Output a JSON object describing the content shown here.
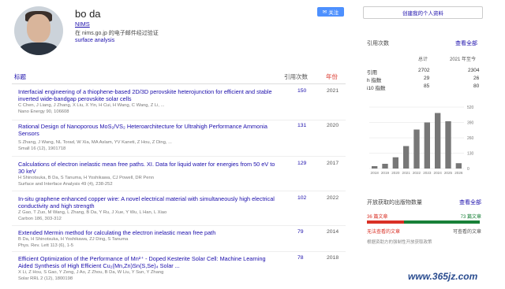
{
  "profile": {
    "name": "bo da",
    "affiliation": "NIMS",
    "email": "在 nims.go.jp 的电子邮件经过验证",
    "interest": "surface analysis",
    "follow_label": "关注"
  },
  "table": {
    "headers": {
      "title": "标题",
      "cited_by": "引用次数",
      "year": "年份"
    },
    "rows": [
      {
        "title": "Interfacial engineering of a thiophene-based 2D/3D perovskite heterojunction for efficient and stable inverted wide-bandgap perovskite solar cells",
        "authors": "C Chen, J Liang, J Zhang, X Liu, X Yin, H Cui, H Wang, C Wang, Z Li, ...",
        "venue": "Nano Energy 90, 106608",
        "cites": "150",
        "year": "2021"
      },
      {
        "title": "Rational Design of Nanoporous MoS₂/VS₂ Heteroarchitecture for Ultrahigh Performance Ammonia Sensors",
        "authors": "S Zhang, J Wang, NL Torad, W Xia, MA Aslam, YV Kaneti, Z Hou, Z Ding, ...",
        "venue": "Small 16 (12), 1901718",
        "cites": "131",
        "year": "2020"
      },
      {
        "title": "Calculations of electron inelastic mean free paths. XI. Data for liquid water for energies from 50 eV to 30 keV",
        "authors": "H Shinotsuka, B Da, S Tanuma, H Yoshikawa, CJ Powell, DR Penn",
        "venue": "Surface and Interface Analysis 49 (4), 238-252",
        "cites": "129",
        "year": "2017"
      },
      {
        "title": "In-situ graphene enhanced copper wire: A novel electrical material with simultaneously high electrical conductivity and high strength",
        "authors": "Z Gao, T Zuo, M Wang, L Zhang, B Da, Y Ru, J Xue, Y Wu, L Han, L Xiao",
        "venue": "Carbon 186, 303-312",
        "cites": "102",
        "year": "2022"
      },
      {
        "title": "Extended Mermin method for calculating the electron inelastic mean free path",
        "authors": "B Da, H Shinotsuka, H Yoshikawa, ZJ Ding, S Tanuma",
        "venue": "Phys. Rev. Lett 113 (6), 1-5",
        "cites": "79",
        "year": "2014"
      },
      {
        "title": "Efficient Optimization of the Performance of Mn²⁺ - Doped Kesterite Solar Cell: Machine Learning Aided Synthesis of High Efficient Cu₂(Mn,Zn)Sn(S,Se)₄ Solar ...",
        "authors": "X Li, Z Hou, S Gao, Y Zeng, J Ao, Z Zhou, B Da, W Liu, Y Sun, Y Zhang",
        "venue": "Solar RRL 2 (12), 1800198",
        "cites": "78",
        "year": "2018"
      }
    ]
  },
  "sidebar": {
    "create_profile": "创建我的个人资料",
    "cited_by_title": "引用次数",
    "view_all": "查看全部",
    "metrics": {
      "col_all": "总计",
      "col_since": "2021 年至今",
      "rows": [
        {
          "label": "引用",
          "all": "2702",
          "since": "2304"
        },
        {
          "label": "h 指数",
          "all": "29",
          "since": "26"
        },
        {
          "label": "i10 指数",
          "all": "85",
          "since": "80"
        }
      ]
    },
    "open_access": {
      "title": "开放获取的出版物数量",
      "view_all": "查看全部",
      "not_available": "36 篇文章",
      "available": "73 篇文章",
      "not_available_label": "无法查看的文章",
      "available_label": "可查看的文章",
      "available_fraction": 0.67,
      "mandate": "根据资助方的强制性开放获取政策"
    }
  },
  "chart_data": {
    "type": "bar",
    "categories": [
      "2018",
      "2019",
      "2020",
      "2021",
      "2022",
      "2023",
      "2024",
      "2025",
      "2026"
    ],
    "values": [
      20,
      40,
      95,
      190,
      330,
      390,
      470,
      400,
      45
    ],
    "yticks": [
      "520",
      "390",
      "260",
      "130",
      "0"
    ],
    "ylim": [
      0,
      520
    ],
    "color": "#777777"
  },
  "watermark": "www.365jz.com"
}
